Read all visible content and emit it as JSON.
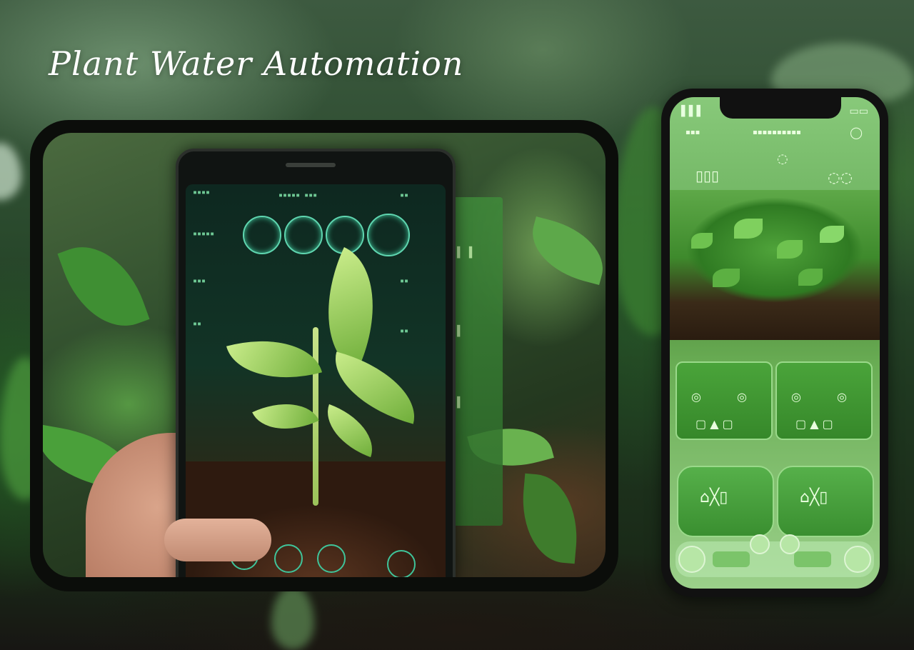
{
  "title": "Plant Water Automation",
  "scene": {
    "left_photo": "hand-holding-phone-plant-photo",
    "right_mockup": "phone-app-mockup"
  },
  "colors": {
    "title_text": "#ffffff",
    "frame": "#0b0d0a",
    "ui_teal": "#5fd6b0",
    "app_green": "#4aa43a",
    "app_light": "#9bd08a"
  }
}
